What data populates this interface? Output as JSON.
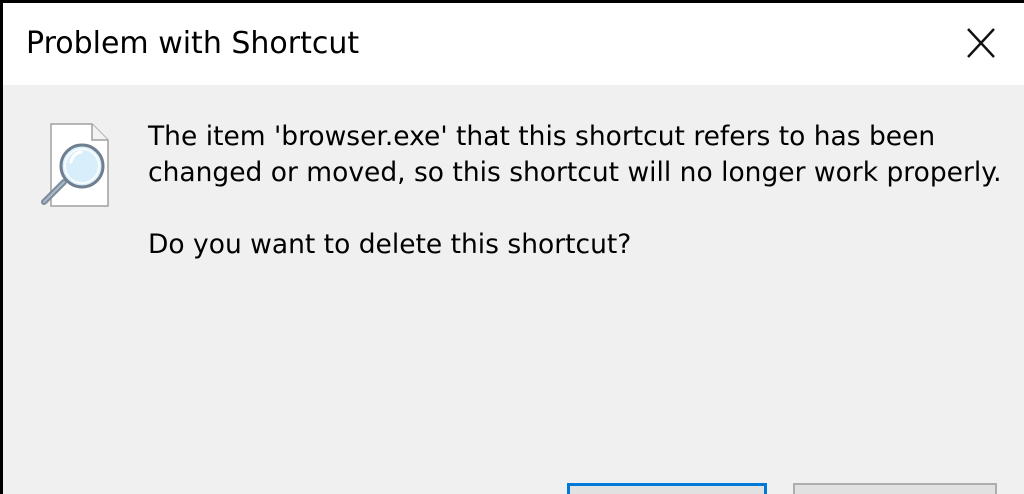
{
  "window": {
    "title": "Problem with Shortcut"
  },
  "message": {
    "line1": "The item 'browser.exe' that this shortcut refers to has been",
    "line2": "changed or moved, so this shortcut will no longer work properly.",
    "question": "Do you want to delete this shortcut?"
  },
  "buttons": {
    "yes_label": "",
    "no_label": ""
  },
  "icons": {
    "close": "close-icon",
    "document": "document-search-icon"
  },
  "colors": {
    "titlebar_bg": "#ffffff",
    "body_bg": "#f0f0f0",
    "default_button_border": "#0078d7"
  }
}
